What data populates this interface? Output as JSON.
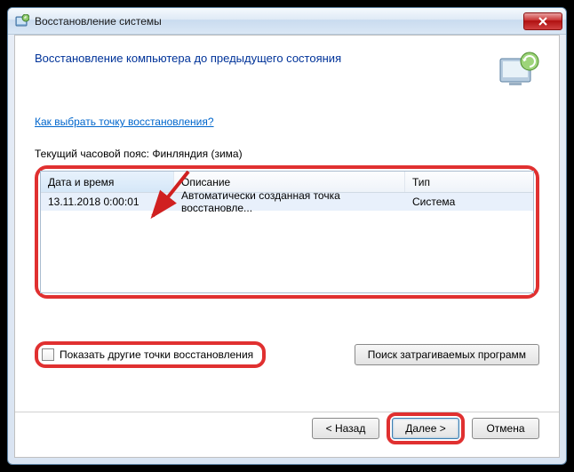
{
  "window": {
    "title": "Восстановление системы"
  },
  "header": {
    "heading": "Восстановление компьютера до предыдущего состояния"
  },
  "help_link": "Как выбрать точку восстановления?",
  "timezone_label": "Текущий часовой пояс: Финляндия (зима)",
  "table": {
    "columns": {
      "date": "Дата и время",
      "desc": "Описание",
      "type": "Тип"
    },
    "rows": [
      {
        "date": "13.11.2018 0:00:01",
        "desc": "Автоматически созданная точка восстановле...",
        "type": "Система"
      }
    ]
  },
  "show_more_checkbox": "Показать другие точки восстановления",
  "affected_programs_btn": "Поиск затрагиваемых программ",
  "buttons": {
    "back": "< Назад",
    "next": "Далее >",
    "cancel": "Отмена"
  }
}
